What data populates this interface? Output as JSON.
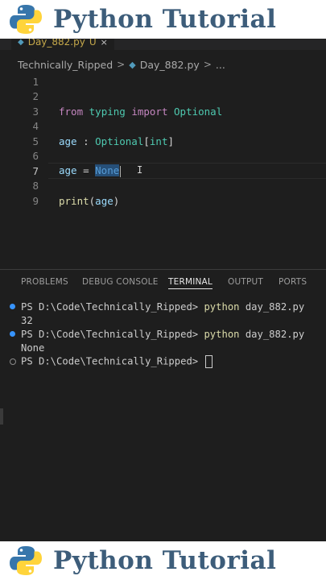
{
  "banner": {
    "title": "Python Tutorial"
  },
  "tab": {
    "filename": "Day_882.py",
    "modified_marker": "U",
    "close_glyph": "×"
  },
  "breadcrumb": {
    "folder": "Technically_Ripped",
    "separator": ">",
    "file": "Day_882.py",
    "ellipsis": "..."
  },
  "editor": {
    "line_numbers": [
      "1",
      "2",
      "3",
      "4",
      "5",
      "6",
      "7",
      "8",
      "9"
    ],
    "line3": {
      "from": "from",
      "module": "typing",
      "import": "import",
      "name": "Optional"
    },
    "line5": {
      "var": "age",
      "colon": " : ",
      "type": "Optional",
      "bracket_open": "[",
      "inner": "int",
      "bracket_close": "]"
    },
    "line7": {
      "var": "age",
      "eq": " = ",
      "value": "None"
    },
    "line9": {
      "fn": "print",
      "open": "(",
      "arg": "age",
      "close": ")"
    }
  },
  "panel": {
    "tabs": [
      "PROBLEMS",
      "DEBUG CONSOLE",
      "TERMINAL",
      "OUTPUT",
      "PORTS"
    ],
    "active_tab": "TERMINAL"
  },
  "terminal": {
    "prompt": "PS D:\\Code\\Technically_Ripped> ",
    "cmd1": "python",
    "arg1": " day_882.py",
    "out1": "32",
    "cmd2": "python",
    "arg2": " day_882.py",
    "out2": "None"
  },
  "colors": {
    "accent_blue": "#3794ff",
    "banner_text": "#3d5d7a",
    "python_blue": "#3776ab",
    "python_yellow": "#ffd43b"
  }
}
